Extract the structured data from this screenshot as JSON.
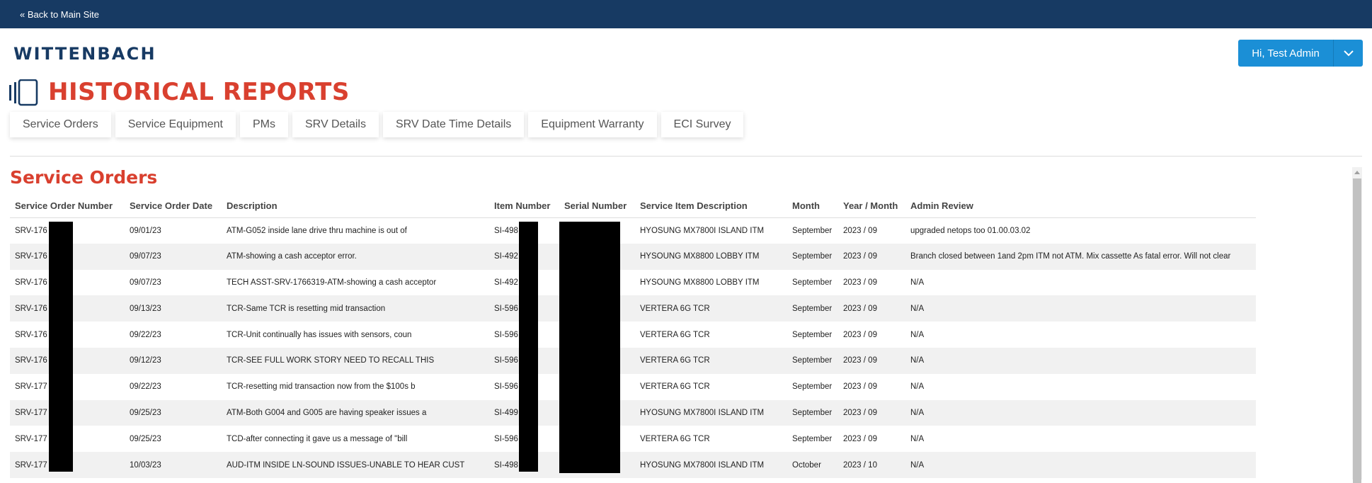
{
  "topbar": {
    "back_label": "« Back to Main Site"
  },
  "brand": {
    "logo_text": "WITTENBACH"
  },
  "user_menu": {
    "greeting": "Hi, Test Admin"
  },
  "page": {
    "title": "HISTORICAL REPORTS",
    "section_title": "Service Orders"
  },
  "tabs": [
    "Service Orders",
    "Service Equipment",
    "PMs",
    "SRV Details",
    "SRV Date Time Details",
    "Equipment Warranty",
    "ECI Survey"
  ],
  "table": {
    "columns": [
      "Service Order Number",
      "Service Order Date",
      "Description",
      "Item Number",
      "Serial Number",
      "Service Item Description",
      "Month",
      "Year / Month",
      "Admin Review"
    ],
    "rows": [
      [
        "SRV-176",
        "09/01/23",
        "ATM-G052 inside lane drive thru machine is out of",
        "SI-498",
        "",
        "HYOSUNG MX7800I ISLAND ITM",
        "September",
        "2023 / 09",
        "upgraded netops too 01.00.03.02"
      ],
      [
        "SRV-176",
        "09/07/23",
        "ATM-showing a cash acceptor error.",
        "SI-492",
        "",
        "HYSOUNG MX8800 LOBBY ITM",
        "September",
        "2023 / 09",
        "Branch closed between 1and 2pm ITM not ATM. Mix cassette As fatal error. Will not clear"
      ],
      [
        "SRV-176",
        "09/07/23",
        "TECH ASST-SRV-1766319-ATM-showing a cash acceptor",
        "SI-492",
        "",
        "HYSOUNG MX8800 LOBBY ITM",
        "September",
        "2023 / 09",
        "N/A"
      ],
      [
        "SRV-176",
        "09/13/23",
        "TCR-Same TCR is resetting mid transaction",
        "SI-596",
        "",
        "VERTERA 6G TCR",
        "September",
        "2023 / 09",
        "N/A"
      ],
      [
        "SRV-176",
        "09/22/23",
        "TCR-Unit continually has issues with sensors, coun",
        "SI-596",
        "",
        "VERTERA 6G TCR",
        "September",
        "2023 / 09",
        "N/A"
      ],
      [
        "SRV-176",
        "09/12/23",
        "TCR-SEE FULL WORK STORY NEED TO RECALL THIS",
        "SI-596",
        "",
        "VERTERA 6G TCR",
        "September",
        "2023 / 09",
        "N/A"
      ],
      [
        "SRV-177",
        "09/22/23",
        "TCR-resetting mid transaction now from the $100s b",
        "SI-596",
        "",
        "VERTERA 6G TCR",
        "September",
        "2023 / 09",
        "N/A"
      ],
      [
        "SRV-177",
        "09/25/23",
        "ATM-Both G004 and G005 are having speaker issues a",
        "SI-499",
        "",
        "HYOSUNG MX7800I ISLAND ITM",
        "September",
        "2023 / 09",
        "N/A"
      ],
      [
        "SRV-177",
        "09/25/23",
        "TCD-after connecting it gave us a message of \"bill",
        "SI-596",
        "",
        "VERTERA 6G TCR",
        "September",
        "2023 / 09",
        "N/A"
      ],
      [
        "SRV-177",
        "10/03/23",
        "AUD-ITM INSIDE LN-SOUND ISSUES-UNABLE TO HEAR CUST",
        "SI-498",
        "",
        "HYOSUNG MX7800I ISLAND ITM",
        "October",
        "2023 / 10",
        "N/A"
      ]
    ]
  },
  "icons": {
    "page_icon": "cards-icon",
    "caret": "chevron-down-icon",
    "scroll_up": "scroll-up-arrow-icon"
  },
  "colors": {
    "topbar": "#173a63",
    "accent_red": "#d9402f",
    "button_blue": "#1b8fd6"
  }
}
